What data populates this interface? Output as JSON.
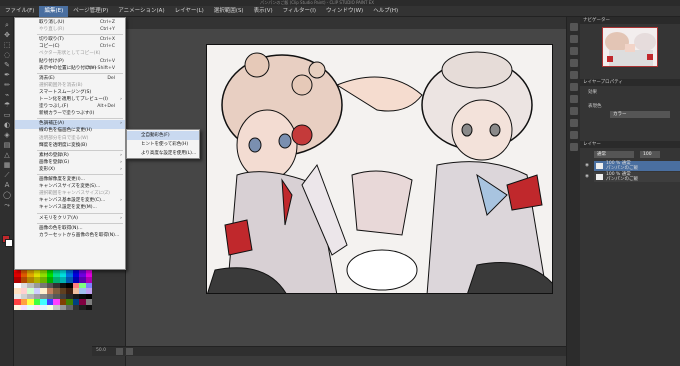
{
  "window": {
    "title": "パンパンのご飯 (Clip Studio Paint) - CLIP STUDIO PAINT EX"
  },
  "menubar": {
    "items": [
      {
        "label": "ファイル(F)"
      },
      {
        "label": "編集(E)",
        "active": true
      },
      {
        "label": "ページ管理(P)"
      },
      {
        "label": "アニメーション(A)"
      },
      {
        "label": "レイヤー(L)"
      },
      {
        "label": "選択範囲(S)"
      },
      {
        "label": "表示(V)"
      },
      {
        "label": "フィルター(I)"
      },
      {
        "label": "ウィンドウ(W)"
      },
      {
        "label": "ヘルプ(H)"
      }
    ]
  },
  "edit_menu": {
    "items": [
      {
        "label": "取り消し(U)",
        "shortcut": "Ctrl+Z"
      },
      {
        "label": "やり直し(R)",
        "shortcut": "Ctrl+Y",
        "disabled": true
      },
      {
        "sep": true
      },
      {
        "label": "切り取り(T)",
        "shortcut": "Ctrl+X"
      },
      {
        "label": "コピー(C)",
        "shortcut": "Ctrl+C"
      },
      {
        "label": "ベクター形状としてコピー(K)",
        "disabled": true
      },
      {
        "label": "貼り付け(P)",
        "shortcut": "Ctrl+V"
      },
      {
        "label": "表示中の位置に貼り付け(V)",
        "shortcut": "Ctrl+Shift+V"
      },
      {
        "sep": true
      },
      {
        "label": "消去(E)",
        "shortcut": "Del"
      },
      {
        "label": "選択範囲外を消去(B)",
        "disabled": true
      },
      {
        "label": "スマートスムージング(S)"
      },
      {
        "label": "トーン化を適用してプレビュー(I)",
        "arrow": true
      },
      {
        "label": "塗りつぶし(F)",
        "shortcut": "Alt+Del"
      },
      {
        "label": "新規カラーで塗りつぶす(I)"
      },
      {
        "sep": true
      },
      {
        "label": "色調補正(A)",
        "arrow": true,
        "highlight": true
      },
      {
        "label": "線の色を描画色に変更(H)"
      },
      {
        "label": "透明部分を白で塗る(W)",
        "disabled": true
      },
      {
        "label": "輝度を透明度に変換(B)"
      },
      {
        "sep": true
      },
      {
        "label": "素材の登録(R)",
        "arrow": true
      },
      {
        "label": "画像を登録(G)",
        "arrow": true
      },
      {
        "label": "変形(X)",
        "arrow": true
      },
      {
        "sep": true
      },
      {
        "label": "画像解像度を変更(I)..."
      },
      {
        "label": "キャンバスサイズを変更(S)..."
      },
      {
        "label": "選択範囲をキャンバスサイズに(Z)",
        "disabled": true
      },
      {
        "label": "キャンバス基本設定を変更(C)...",
        "arrow": true
      },
      {
        "label": "キャンバス設定を変更(M)..."
      },
      {
        "sep": true
      },
      {
        "label": "メモリをクリア(A)",
        "arrow": true
      },
      {
        "sep": true
      },
      {
        "label": "画像の色を取得(N)..."
      },
      {
        "label": "カラーセットから画像の色を取得(N)..."
      }
    ]
  },
  "submenu": {
    "items": [
      {
        "label": "全自動彩色(F)",
        "highlight": true
      },
      {
        "label": "ヒントを使って彩色(H)"
      },
      {
        "label": "より高度な設定を使用(L)..."
      }
    ]
  },
  "layers": {
    "header": "レイヤー",
    "blend": "通常",
    "opacity": "100",
    "rows": [
      {
        "name": "100 % 通常",
        "sub": "パンパンのご飯",
        "selected": true
      },
      {
        "name": "100 % 通常",
        "sub": "パンパンのご飯"
      }
    ]
  },
  "panels": {
    "navigator": "ナビゲーター",
    "layer_property": "レイヤープロパティ",
    "effect": "効果",
    "expression": "表現色",
    "color": "カラー"
  },
  "colors": {
    "accent": "#4a6fa0",
    "highlight": "#c9d9f0",
    "swatches": [
      "#ff0000",
      "#ff6a00",
      "#ffc000",
      "#ffff00",
      "#b0ff00",
      "#00ff00",
      "#00ffa0",
      "#00ffff",
      "#0080ff",
      "#0000ff",
      "#8000ff",
      "#ff00ff",
      "#e00000",
      "#e05a00",
      "#e0a800",
      "#e0e000",
      "#90e000",
      "#00e000",
      "#00e090",
      "#00e0e0",
      "#0070e0",
      "#0000e0",
      "#7000e0",
      "#e000e0",
      "#b00000",
      "#b04800",
      "#b08400",
      "#b0b000",
      "#70b000",
      "#00b000",
      "#00b070",
      "#00b0b0",
      "#0058b0",
      "#0000b0",
      "#5800b0",
      "#b000b0",
      "#ffffff",
      "#dddddd",
      "#bbbbbb",
      "#999999",
      "#777777",
      "#555555",
      "#333333",
      "#111111",
      "#000000",
      "#ff8080",
      "#80ff80",
      "#8080ff",
      "#ffe0c0",
      "#ffd0d0",
      "#d0ffd0",
      "#d0d0ff",
      "#fff0d0",
      "#c08060",
      "#806040",
      "#604020",
      "#402010",
      "#f0c0a0",
      "#a0c0f0",
      "#c0a0f0",
      "#e8e8e8",
      "#d0d0d0",
      "#b8b8b8",
      "#a0a0a0",
      "#888888",
      "#707070",
      "#585858",
      "#404040",
      "#282828",
      "#181818",
      "#0a0a0a",
      "#000000",
      "#ff4040",
      "#ffa040",
      "#ffff40",
      "#40ff40",
      "#40ffff",
      "#4040ff",
      "#ff40ff",
      "#804000",
      "#408000",
      "#004080",
      "#800040",
      "#808080",
      "#fff5e0",
      "#f5e0ff",
      "#e0fff5",
      "#ffe0f5",
      "#e0f5ff",
      "#f5ffe0",
      "#c8c8c8",
      "#969696",
      "#646464",
      "#323232",
      "#1e1e1e",
      "#0f0f0f"
    ]
  },
  "status": {
    "zoom": "50.0"
  }
}
